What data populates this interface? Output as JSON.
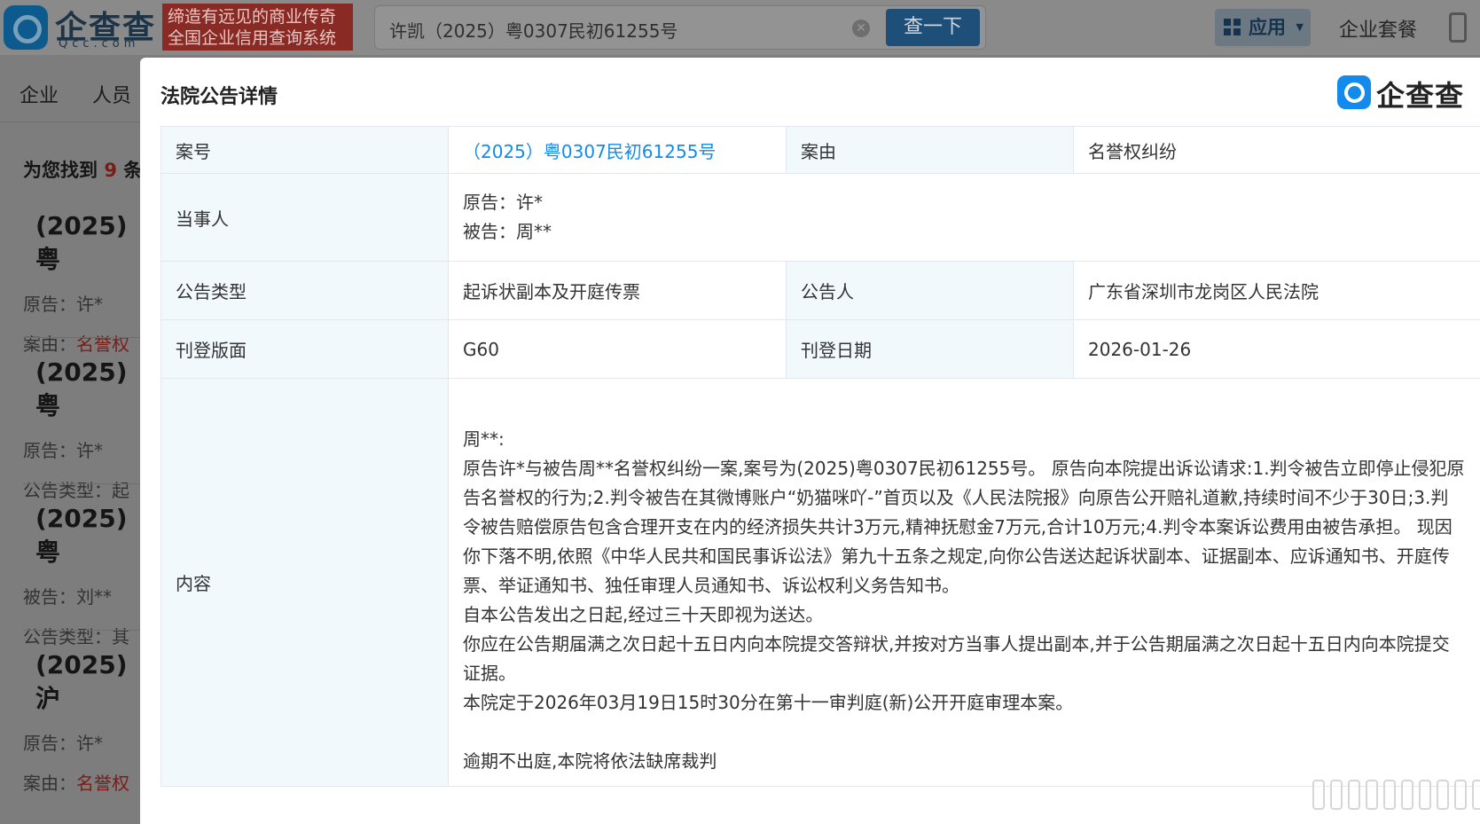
{
  "topbar": {
    "logo_text": "企查查",
    "logo_sub": "Qcc.com",
    "slogan_line1": "缔造有远见的商业传奇",
    "slogan_line2": "全国企业信用查询系统",
    "search_value": "许凯（2025）粤0307民初61255号",
    "search_button": "查一下",
    "apps_label": "应用",
    "suite_label": "企业套餐"
  },
  "nav": {
    "items": [
      "企业",
      "人员"
    ]
  },
  "results": {
    "found_prefix": "为您找到",
    "found_count": "9",
    "found_suffix": "条",
    "items": [
      {
        "title": "(2025) 粤",
        "line1_label": "原告：",
        "line1_value": "许*",
        "line2_label": "案由：",
        "line2_value": "名誉权"
      },
      {
        "title": "(2025) 粤",
        "line1_label": "原告：",
        "line1_value": "许*",
        "line2_label": "公告类型：",
        "line2_value": "起"
      },
      {
        "title": "(2025) 粤",
        "line1_label": "被告：",
        "line1_value": "刘**",
        "line2_label": "公告类型：",
        "line2_value": "其"
      },
      {
        "title": "(2025) 沪",
        "line1_label": "原告：",
        "line1_value": "许*",
        "line2_label": "案由：",
        "line2_value": "名誉权"
      }
    ]
  },
  "modal": {
    "title": "法院公告详情",
    "brand": "企查查",
    "rows": {
      "case_no_label": "案号",
      "case_no_value": "（2025）粤0307民初61255号",
      "cause_label": "案由",
      "cause_value": "名誉权纠纷",
      "party_label": "当事人",
      "plaintiff": "原告：许*",
      "defendant": "被告：周**",
      "type_label": "公告类型",
      "type_value": "起诉状副本及开庭传票",
      "announcer_label": "公告人",
      "announcer_value": "广东省深圳市龙岗区人民法院",
      "page_label": "刊登版面",
      "page_value": "G60",
      "date_label": "刊登日期",
      "date_value": "2026-01-26",
      "content_label": "内容"
    },
    "content": {
      "p1": "周**:",
      "p2": "原告许*与被告周**名誉权纠纷一案,案号为(2025)粤0307民初61255号。 原告向本院提出诉讼请求:1.判令被告立即停止侵犯原告名誉权的行为;2.判令被告在其微博账户“奶猫咪吖-”首页以及《人民法院报》向原告公开赔礼道歉,持续时间不少于30日;3.判令被告赔偿原告包含合理开支在内的经济损失共计3万元,精神抚慰金7万元,合计10万元;4.判令本案诉讼费用由被告承担。 现因你下落不明,依照《中华人民共和国民事诉讼法》第九十五条之规定,向你公告送达起诉状副本、证据副本、应诉通知书、开庭传票、举证通知书、独任审理人员通知书、诉讼权利义务告知书。",
      "p3": "自本公告发出之日起,经过三十天即视为送达。",
      "p4": "你应在公告期届满之次日起十五日内向本院提交答辩状,并按对方当事人提出副本,并于公告期届满之次日起十五日内向本院提交证据。",
      "p5": "本院定于2026年03月19日15时30分在第十一审判庭(新)公开开庭审理本案。",
      "p6": "逾期不出庭,本院将依法缺席裁判"
    }
  }
}
